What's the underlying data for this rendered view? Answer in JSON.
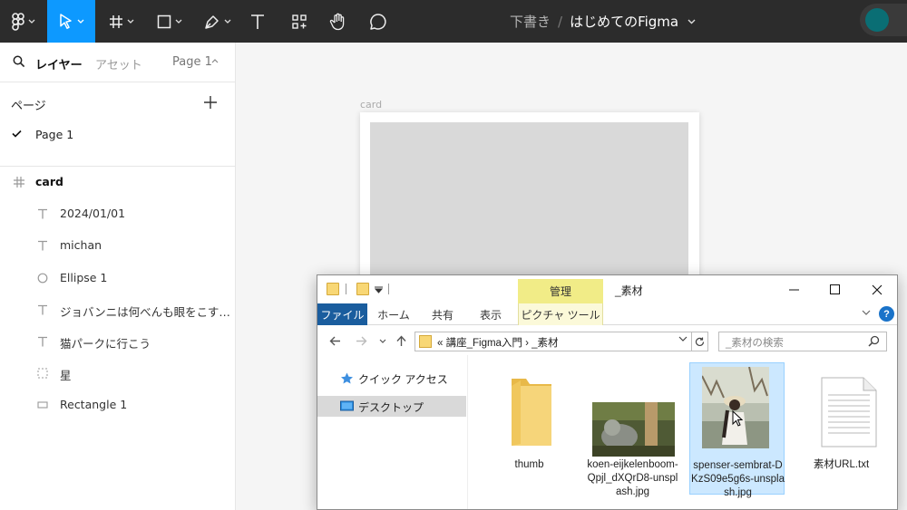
{
  "toolbar": {
    "file_draft": "下書き",
    "file_separator": "/",
    "file_name": "はじめてのFigma",
    "colors": {
      "bg": "#2c2c2c",
      "active": "#0d99ff",
      "avatar": "#0a6e74"
    }
  },
  "left_panel": {
    "tab_layers": "レイヤー",
    "tab_assets": "アセット",
    "current_page_selector": "Page 1",
    "pages_heading": "ページ",
    "pages": [
      {
        "name": "Page 1",
        "selected": true
      }
    ],
    "layers": [
      {
        "name": "card",
        "icon": "frame-icon"
      },
      {
        "name": "2024/01/01",
        "icon": "text-icon"
      },
      {
        "name": "michan",
        "icon": "text-icon"
      },
      {
        "name": "Ellipse 1",
        "icon": "ellipse-icon"
      },
      {
        "name": "ジョバンニは何べんも眼をこす…",
        "icon": "text-icon"
      },
      {
        "name": "猫パークに行こう",
        "icon": "text-icon"
      },
      {
        "name": "星",
        "icon": "section-icon"
      },
      {
        "name": "Rectangle 1",
        "icon": "rectangle-icon"
      }
    ]
  },
  "canvas": {
    "frame_label": "card"
  },
  "explorer": {
    "manage_tab": "管理",
    "title": "_素材",
    "ribbon_tabs": [
      "ファイル",
      "ホーム",
      "共有",
      "表示",
      "ピクチャ ツール"
    ],
    "address_path": "«  講座_Figma入門  ›  _素材",
    "search_placeholder": "_素材の検索",
    "nav_items": [
      {
        "label": "クイック アクセス",
        "selected": false
      },
      {
        "label": "デスクトップ",
        "selected": true
      }
    ],
    "files": [
      {
        "name": "thumb",
        "type": "folder",
        "selected": false
      },
      {
        "name": "koen-eijkelenboom-Qpjl_dXQrD8-unsplash.jpg",
        "type": "image",
        "selected": false
      },
      {
        "name": "spenser-sembrat-DKzS09e5g6s-unsplash.jpg",
        "type": "image",
        "selected": true
      },
      {
        "name": "素材URL.txt",
        "type": "text",
        "selected": false
      }
    ],
    "colors": {
      "file_tab": "#1a5d9e",
      "manage_tab": "#f1ec87",
      "selection": "#cce8ff"
    }
  }
}
